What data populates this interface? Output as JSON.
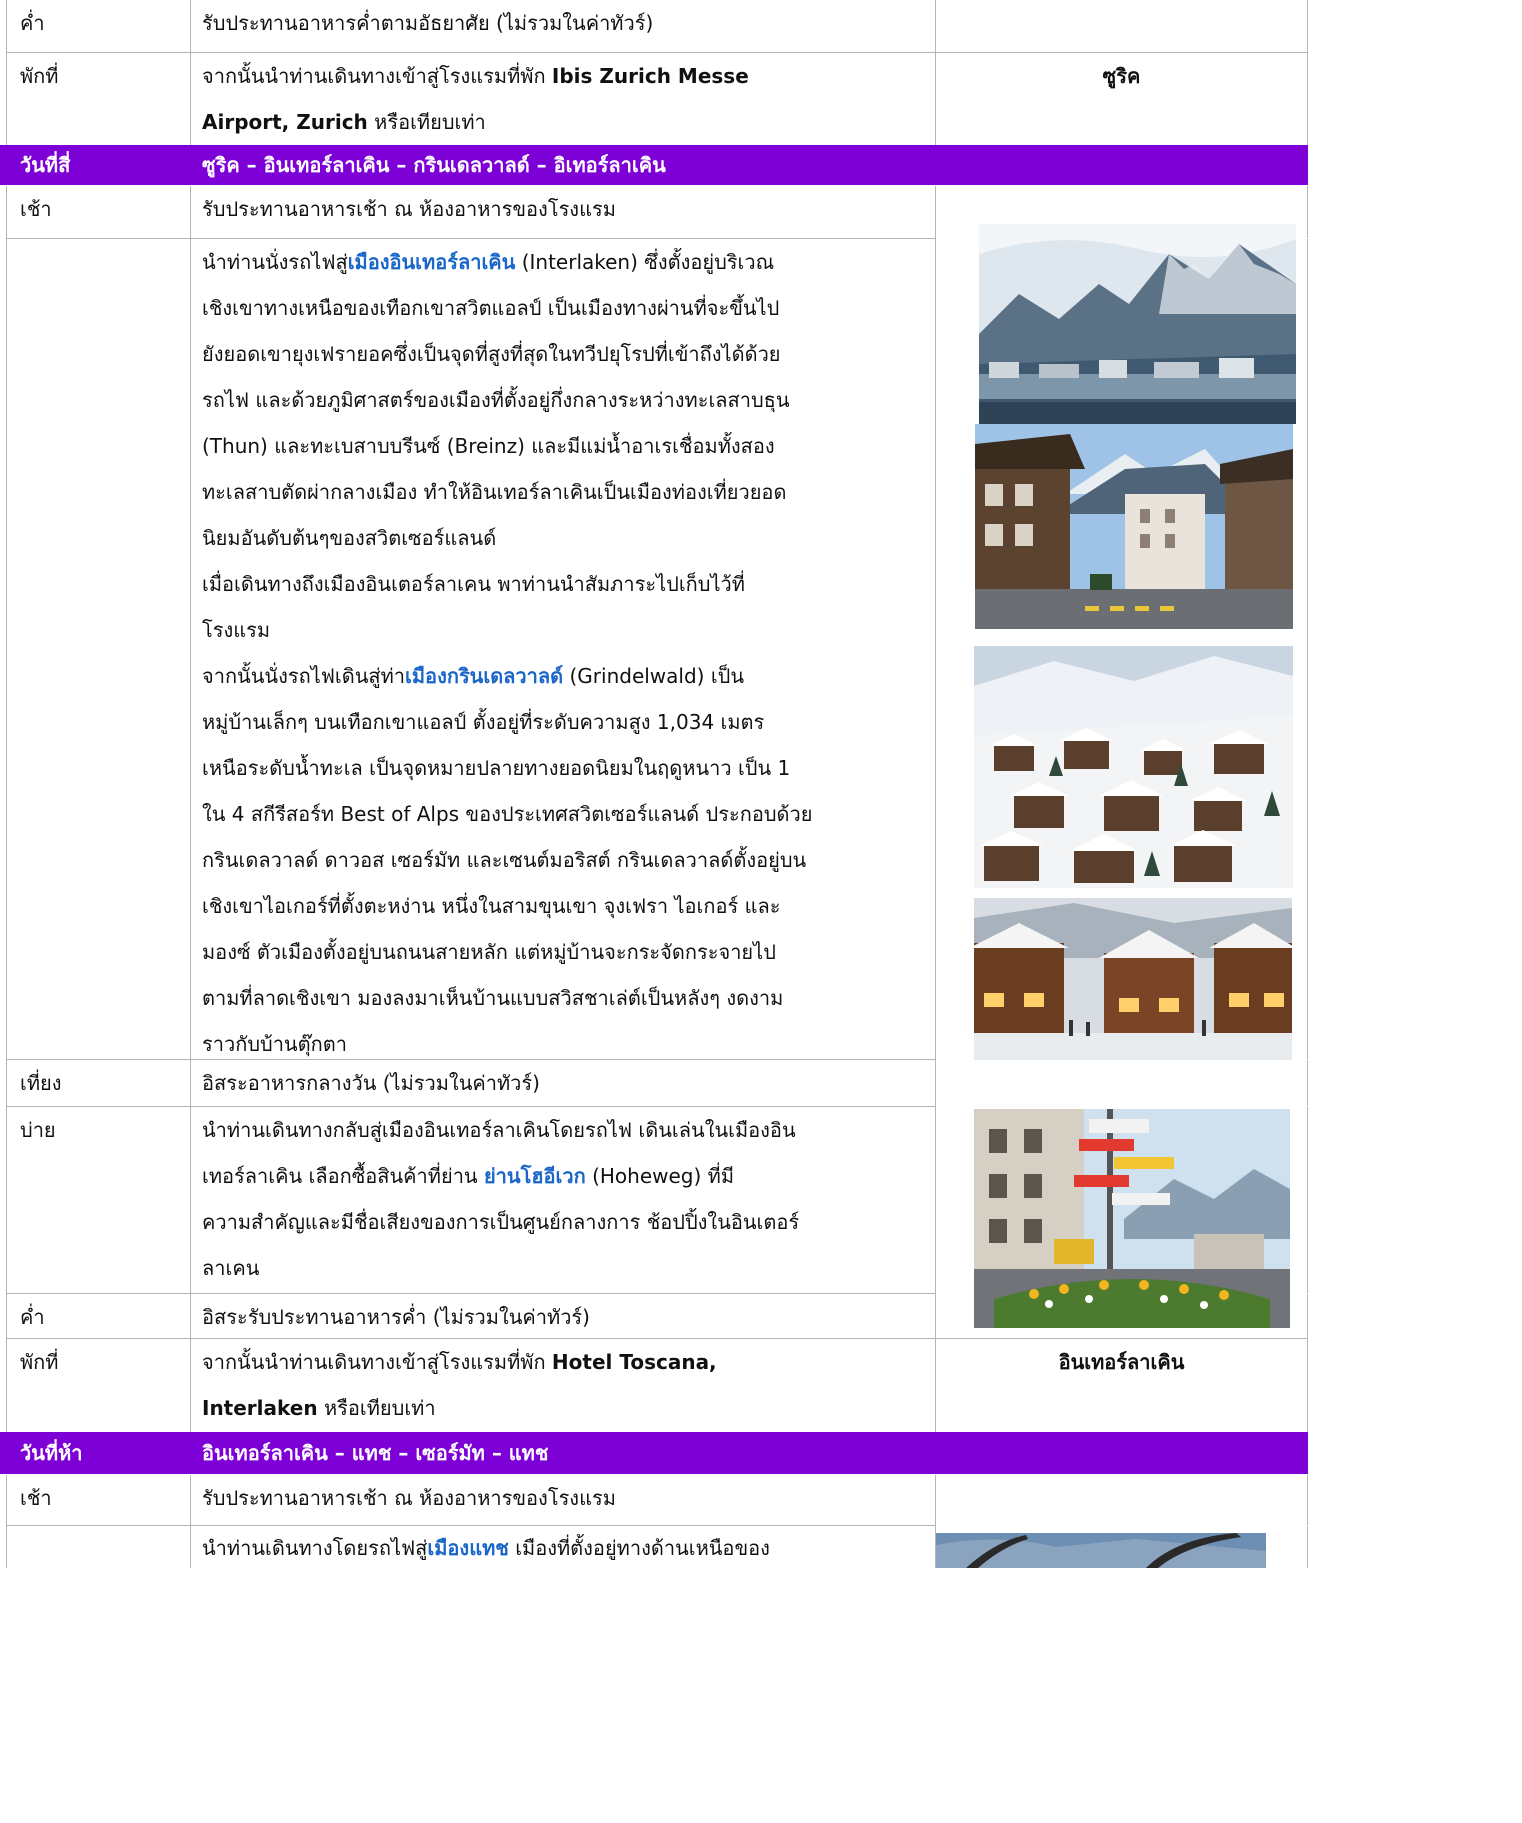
{
  "rows": {
    "r1": {
      "label": "ค่ำ",
      "text": "รับประทานอาหารค่ำตามอัธยาศัย (ไม่รวมในค่าทัวร์)"
    },
    "r2": {
      "label": "พักที่",
      "pre": "จากนั้นนำท่านเดินทางเข้าสู่โรงแรมที่พัก ",
      "bold1": "Ibis Zurich Messe",
      "bold2": "Airport, Zurich",
      "post": " หรือเทียบเท่า",
      "city": "ซูริค"
    },
    "day4": {
      "label": "วันที่สี่",
      "title": "ซูริค – อินเทอร์ลาเคิน – กรินเดลวาลด์ – อิเทอร์ลาเคิน"
    },
    "r4": {
      "label": "เช้า",
      "text": "รับประทานอาหารเช้า ณ ห้องอาหารของโรงแรม"
    },
    "interlaken": {
      "l1_pre": "นำท่านนั่งรถไฟสู่",
      "l1_hl": "เมืองอินเทอร์ลาเคิน",
      "l1_post": " (Interlaken) ซึ่งตั้งอยู่บริเวณ",
      "l2": "เชิงเขาทางเหนือของเทือกเขาสวิตแอลป์ เป็นเมืองทางผ่านที่จะขึ้นไป",
      "l3": "ยังยอดเขายุงเฟรายอคซึ่งเป็นจุดที่สูงที่สุดในทวีปยุโรปที่เข้าถึงได้ด้วย",
      "l4": "รถไฟ และด้วยภูมิศาสตร์ของเมืองที่ตั้งอยู่กึ่งกลางระหว่างทะเลสาบธุน",
      "l5": "(Thun) และทะเบสาบบรีนซ์ (Breinz) และมีแม่น้ำอาเรเชื่อมทั้งสอง",
      "l6": "ทะเลสาบตัดผ่ากลางเมือง ทำให้อินเทอร์ลาเคินเป็นเมืองท่องเที่ยวยอด",
      "l7": "นิยมอันดับต้นๆของสวิตเซอร์แลนด์",
      "l8": "เมื่อเดินทางถึงเมืองอินเตอร์ลาเคน พาท่านนำสัมภาระไปเก็บไว้ที่",
      "l9": "โรงแรม",
      "l10_pre": "จากนั้นนั่งรถไฟเดินสู่ท่า",
      "l10_hl": "เมืองกรินเดลวาลด์",
      "l10_post": " (Grindelwald) เป็น",
      "l11": "หมู่บ้านเล็กๆ บนเทือกเขาแอลป์ ตั้งอยู่ที่ระดับความสูง 1,034 เมตร",
      "l12": "เหนือระดับน้ำทะเล เป็นจุดหมายปลายทางยอดนิยมในฤดูหนาว เป็น 1",
      "l13": "ใน 4 สกีรีสอร์ท Best of Alps ของประเทศสวิตเซอร์แลนด์ ประกอบด้วย",
      "l14": "กรินเดลวาลด์ ดาวอส เซอร์มัท และเซนต์มอริสต์ กรินเดลวาลด์ตั้งอยู่บน",
      "l15": "เชิงเขาไอเกอร์ที่ตั้งตะหง่าน หนึ่งในสามขุนเขา จุงเฟรา ไอเกอร์ และ",
      "l16": "มองซ์ ตัวเมืองตั้งอยู่บนถนนสายหลัก แต่หมู่บ้านจะกระจัดกระจายไป",
      "l17": "ตามที่ลาดเชิงเขา มองลงมาเห็นบ้านแบบสวิสชาเล่ต์เป็นหลังๆ งดงาม",
      "l18": "ราวกับบ้านตุ๊กตา"
    },
    "r6": {
      "label": "เที่ยง",
      "text": "อิสระอาหารกลางวัน (ไม่รวมในค่าทัวร์)"
    },
    "r7": {
      "label": "บ่าย",
      "l1": "นำท่านเดินทางกลับสู่เมืองอินเทอร์ลาเคินโดยรถไฟ เดินเล่นในเมืองอิน",
      "l2_pre": "เทอร์ลาเคิน เลือกซื้อสินค้าที่ย่าน ",
      "l2_hl": "ย่านโฮอีเวก",
      "l2_post": " (Hoheweg) ที่มี",
      "l3": "ความสำคัญและมีชื่อเสียงของการเป็นศูนย์กลางการ ช้อปปิ้งในอินเตอร์",
      "l4": "ลาเคน"
    },
    "r8": {
      "label": "ค่ำ",
      "text": "อิสระรับประทานอาหารค่ำ (ไม่รวมในค่าทัวร์)"
    },
    "r9": {
      "label": "พักที่",
      "pre": "จากนั้นนำท่านเดินทางเข้าสู่โรงแรมที่พัก ",
      "bold1": "Hotel Toscana,",
      "bold2": "Interlaken",
      "post": " หรือเทียบเท่า",
      "city": "อินเทอร์ลาเคิน"
    },
    "day5": {
      "label": "วันที่ห้า",
      "title": "อินเทอร์ลาเคิน – แทช – เซอร์มัท – แทช"
    },
    "r11": {
      "label": "เช้า",
      "text": "รับประทานอาหารเช้า ณ ห้องอาหารของโรงแรม"
    },
    "r12": {
      "pre": "นำท่านเดินทางโดยรถไฟสู่",
      "hl": "เมืองแทช",
      "post": " เมืองที่ตั้งอยู่ทางด้านเหนือของ"
    }
  },
  "images": {
    "photo1": "mountain-lake-town-photo",
    "photo2": "interlaken-street-photo",
    "photo3": "grindelwald-snow-village-photo",
    "photo4": "chalet-shops-snow-photo",
    "photo5": "hoheweg-signpost-photo",
    "photo6": "taesch-photo"
  },
  "colors": {
    "day_header": "#7d00d6",
    "highlight": "#1a66c9"
  }
}
